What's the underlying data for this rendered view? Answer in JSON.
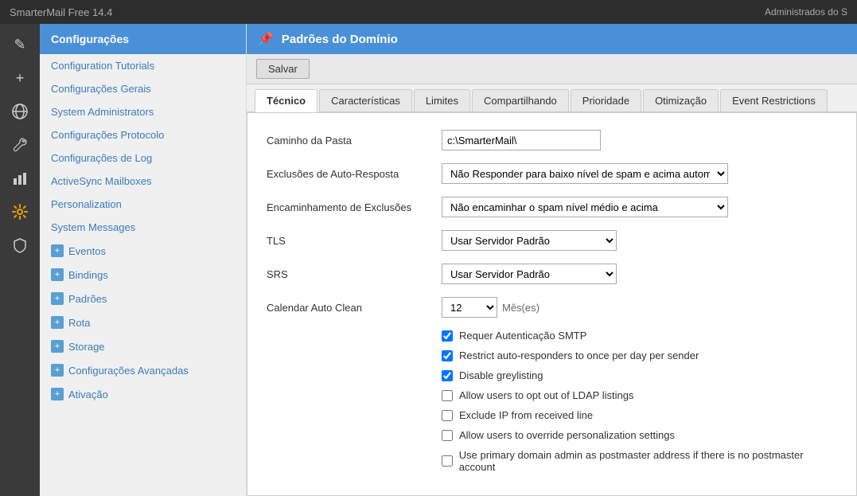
{
  "app": {
    "title": "SmarterMail Free 14.4",
    "admin_label": "Administrados do S"
  },
  "icon_rail": {
    "items": [
      {
        "name": "compose-icon",
        "symbol": "✎"
      },
      {
        "name": "compose-add-icon",
        "symbol": "+"
      },
      {
        "name": "globe-icon",
        "symbol": "🌐"
      },
      {
        "name": "wrench-icon",
        "symbol": "🔧"
      },
      {
        "name": "bar-chart-icon",
        "symbol": "📊"
      },
      {
        "name": "gear-icon",
        "symbol": "⚙"
      },
      {
        "name": "shield-icon",
        "symbol": "🛡"
      }
    ]
  },
  "sidebar": {
    "header": "Configurações",
    "items": [
      {
        "label": "Configuration Tutorials",
        "expandable": false
      },
      {
        "label": "Configurações Gerais",
        "expandable": false
      },
      {
        "label": "System Administrators",
        "expandable": false
      },
      {
        "label": "Configurações Protocolo",
        "expandable": false
      },
      {
        "label": "Configurações de Log",
        "expandable": false
      },
      {
        "label": "ActiveSync Mailboxes",
        "expandable": false
      },
      {
        "label": "Personalization",
        "expandable": false
      },
      {
        "label": "System Messages",
        "expandable": false
      },
      {
        "label": "Eventos",
        "expandable": true
      },
      {
        "label": "Bindings",
        "expandable": true
      },
      {
        "label": "Padrões",
        "expandable": true
      },
      {
        "label": "Rota",
        "expandable": true
      },
      {
        "label": "Storage",
        "expandable": true
      },
      {
        "label": "Configurações Avançadas",
        "expandable": true
      },
      {
        "label": "Ativação",
        "expandable": true
      }
    ]
  },
  "content": {
    "header": "Padrões do Domínio",
    "save_button": "Salvar",
    "tabs": [
      {
        "label": "Técnico",
        "active": true
      },
      {
        "label": "Características"
      },
      {
        "label": "Limites"
      },
      {
        "label": "Compartilhando"
      },
      {
        "label": "Prioridade"
      },
      {
        "label": "Otimização"
      },
      {
        "label": "Event Restrictions"
      }
    ],
    "form": {
      "fields": [
        {
          "label": "Caminho da Pasta",
          "type": "text",
          "value": "c:\\SmarterMail\\"
        },
        {
          "label": "Exclusões de Auto-Resposta",
          "type": "select",
          "value": "Não Responder para baixo nível de spam e acima automática",
          "options": [
            "Não Responder para baixo nível de spam e acima automática"
          ]
        },
        {
          "label": "Encaminhamento de Exclusões",
          "type": "select",
          "value": "Não encaminhar o spam nível médio e acima",
          "options": [
            "Não encaminhar o spam nível médio e acima"
          ]
        },
        {
          "label": "TLS",
          "type": "select",
          "value": "Usar Servidor Padrão",
          "options": [
            "Usar Servidor Padrão"
          ]
        },
        {
          "label": "SRS",
          "type": "select",
          "value": "Usar Servidor Padrão",
          "options": [
            "Usar Servidor Padrão"
          ]
        },
        {
          "label": "Calendar Auto Clean",
          "type": "calendar-clean",
          "number_value": "12",
          "unit_value": "Mês(es)"
        }
      ],
      "checkboxes": [
        {
          "label": "Requer Autenticação SMTP",
          "checked": true
        },
        {
          "label": "Restrict auto-responders to once per day per sender",
          "checked": true
        },
        {
          "label": "Disable greylisting",
          "checked": true
        },
        {
          "label": "Allow users to opt out of LDAP listings",
          "checked": false
        },
        {
          "label": "Exclude IP from received line",
          "checked": false
        },
        {
          "label": "Allow users to override personalization settings",
          "checked": false
        },
        {
          "label": "Use primary domain admin as postmaster address if there is no postmaster account",
          "checked": false
        }
      ]
    }
  }
}
